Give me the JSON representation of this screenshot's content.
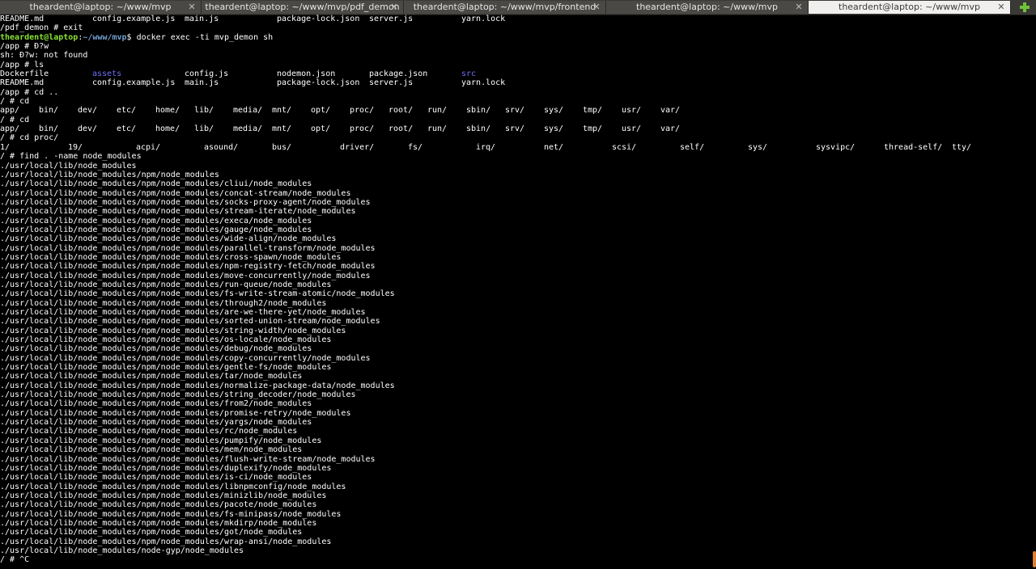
{
  "tabs": [
    {
      "title": "theardent@laptop: ~/www/mvp",
      "active": false
    },
    {
      "title": "theardent@laptop: ~/www/mvp/pdf_demon",
      "active": false
    },
    {
      "title": "theardent@laptop: ~/www/mvp/frontend",
      "active": false
    },
    {
      "title": "theardent@laptop: ~/www/mvp",
      "active": false
    },
    {
      "title": "theardent@laptop: ~/www/mvp",
      "active": true
    }
  ],
  "icons": {
    "tab_close": "close-icon",
    "new_tab": "plus-icon"
  },
  "colors": {
    "user": "#8ae234",
    "path": "#729fcf",
    "dir": "#6f6ff8",
    "background": "#000000",
    "foreground": "#ffffff"
  },
  "terminal": {
    "lines": [
      {
        "cols": [
          "README.md",
          "config.example.js",
          "main.js",
          "package-lock.json",
          "server.js",
          "yarn.lock"
        ]
      },
      {
        "text": "/pdf_demon # exit"
      },
      {
        "prompt": {
          "user": "theardent@laptop",
          "path": "~/www/mvp",
          "cmd": "$ docker exec -ti mvp_demon sh"
        }
      },
      {
        "text": "/app # Ð?w"
      },
      {
        "text": "sh: Ð?w: not found"
      },
      {
        "text": "/app # ls"
      },
      {
        "cols": [
          "Dockerfile",
          "assets",
          "config.js",
          "nodemon.json",
          "package.json",
          "src"
        ],
        "dirs": [
          1,
          5
        ]
      },
      {
        "cols": [
          "README.md",
          "config.example.js",
          "main.js",
          "package-lock.json",
          "server.js",
          "yarn.lock"
        ]
      },
      {
        "text": "/app # cd .."
      },
      {
        "text": "/ # cd"
      },
      {
        "cols": [
          "app/",
          "bin/",
          "dev/",
          "etc/",
          "home/",
          "lib/",
          "media/",
          "mnt/",
          "opt/",
          "proc/",
          "root/",
          "run/",
          "sbin/",
          "srv/",
          "sys/",
          "tmp/",
          "usr/",
          "var/"
        ]
      },
      {
        "text": "/ # cd"
      },
      {
        "cols": [
          "app/",
          "bin/",
          "dev/",
          "etc/",
          "home/",
          "lib/",
          "media/",
          "mnt/",
          "opt/",
          "proc/",
          "root/",
          "run/",
          "sbin/",
          "srv/",
          "sys/",
          "tmp/",
          "usr/",
          "var/"
        ]
      },
      {
        "text": "/ # cd proc/"
      },
      {
        "cols": [
          "1/",
          "19/",
          "acpi/",
          "asound/",
          "bus/",
          "driver/",
          "fs/",
          "irq/",
          "net/",
          "scsi/",
          "self/",
          "sys/",
          "sysvipc/",
          "thread-self/",
          "tty/"
        ]
      },
      {
        "text": "/ # find . -name node_modules"
      },
      {
        "text": "./usr/local/lib/node_modules"
      },
      {
        "text": "./usr/local/lib/node_modules/npm/node_modules"
      },
      {
        "text": "./usr/local/lib/node_modules/npm/node_modules/cliui/node_modules"
      },
      {
        "text": "./usr/local/lib/node_modules/npm/node_modules/concat-stream/node_modules"
      },
      {
        "text": "./usr/local/lib/node_modules/npm/node_modules/socks-proxy-agent/node_modules"
      },
      {
        "text": "./usr/local/lib/node_modules/npm/node_modules/stream-iterate/node_modules"
      },
      {
        "text": "./usr/local/lib/node_modules/npm/node_modules/execa/node_modules"
      },
      {
        "text": "./usr/local/lib/node_modules/npm/node_modules/gauge/node_modules"
      },
      {
        "text": "./usr/local/lib/node_modules/npm/node_modules/wide-align/node_modules"
      },
      {
        "text": "./usr/local/lib/node_modules/npm/node_modules/parallel-transform/node_modules"
      },
      {
        "text": "./usr/local/lib/node_modules/npm/node_modules/cross-spawn/node_modules"
      },
      {
        "text": "./usr/local/lib/node_modules/npm/node_modules/npm-registry-fetch/node_modules"
      },
      {
        "text": "./usr/local/lib/node_modules/npm/node_modules/move-concurrently/node_modules"
      },
      {
        "text": "./usr/local/lib/node_modules/npm/node_modules/run-queue/node_modules"
      },
      {
        "text": "./usr/local/lib/node_modules/npm/node_modules/fs-write-stream-atomic/node_modules"
      },
      {
        "text": "./usr/local/lib/node_modules/npm/node_modules/through2/node_modules"
      },
      {
        "text": "./usr/local/lib/node_modules/npm/node_modules/are-we-there-yet/node_modules"
      },
      {
        "text": "./usr/local/lib/node_modules/npm/node_modules/sorted-union-stream/node_modules"
      },
      {
        "text": "./usr/local/lib/node_modules/npm/node_modules/string-width/node_modules"
      },
      {
        "text": "./usr/local/lib/node_modules/npm/node_modules/os-locale/node_modules"
      },
      {
        "text": "./usr/local/lib/node_modules/npm/node_modules/debug/node_modules"
      },
      {
        "text": "./usr/local/lib/node_modules/npm/node_modules/copy-concurrently/node_modules"
      },
      {
        "text": "./usr/local/lib/node_modules/npm/node_modules/gentle-fs/node_modules"
      },
      {
        "text": "./usr/local/lib/node_modules/npm/node_modules/tar/node_modules"
      },
      {
        "text": "./usr/local/lib/node_modules/npm/node_modules/normalize-package-data/node_modules"
      },
      {
        "text": "./usr/local/lib/node_modules/npm/node_modules/string_decoder/node_modules"
      },
      {
        "text": "./usr/local/lib/node_modules/npm/node_modules/from2/node_modules"
      },
      {
        "text": "./usr/local/lib/node_modules/npm/node_modules/promise-retry/node_modules"
      },
      {
        "text": "./usr/local/lib/node_modules/npm/node_modules/yargs/node_modules"
      },
      {
        "text": "./usr/local/lib/node_modules/npm/node_modules/rc/node_modules"
      },
      {
        "text": "./usr/local/lib/node_modules/npm/node_modules/pumpify/node_modules"
      },
      {
        "text": "./usr/local/lib/node_modules/npm/node_modules/mem/node_modules"
      },
      {
        "text": "./usr/local/lib/node_modules/npm/node_modules/flush-write-stream/node_modules"
      },
      {
        "text": "./usr/local/lib/node_modules/npm/node_modules/duplexify/node_modules"
      },
      {
        "text": "./usr/local/lib/node_modules/npm/node_modules/is-ci/node_modules"
      },
      {
        "text": "./usr/local/lib/node_modules/npm/node_modules/libnpmconfig/node_modules"
      },
      {
        "text": "./usr/local/lib/node_modules/npm/node_modules/minizlib/node_modules"
      },
      {
        "text": "./usr/local/lib/node_modules/npm/node_modules/pacote/node_modules"
      },
      {
        "text": "./usr/local/lib/node_modules/npm/node_modules/fs-minipass/node_modules"
      },
      {
        "text": "./usr/local/lib/node_modules/npm/node_modules/mkdirp/node_modules"
      },
      {
        "text": "./usr/local/lib/node_modules/npm/node_modules/got/node_modules"
      },
      {
        "text": "./usr/local/lib/node_modules/npm/node_modules/wrap-ansi/node_modules"
      },
      {
        "text": "./usr/local/lib/node_modules/node-gyp/node_modules"
      },
      {
        "text": "/ # ^C"
      }
    ]
  }
}
